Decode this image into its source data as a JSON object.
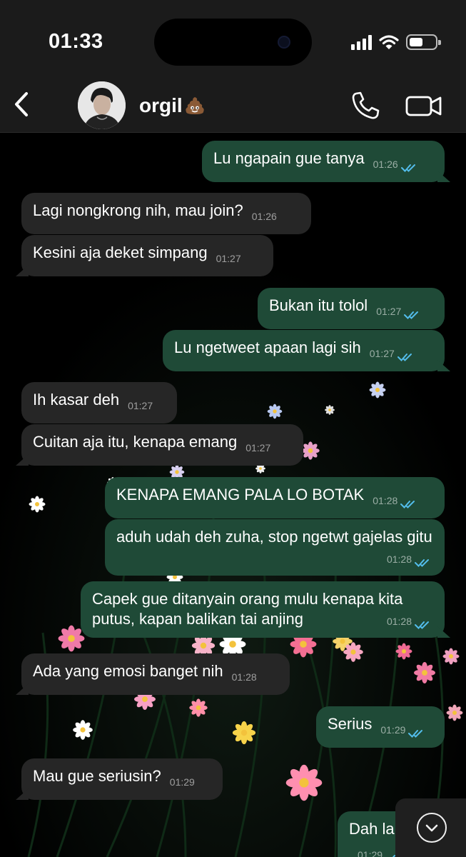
{
  "status_bar": {
    "time": "01:33"
  },
  "header": {
    "contact_name": "orgil",
    "name_emoji_icon": "poop-icon"
  },
  "colors": {
    "outgoing_bubble": "#1f4a37",
    "incoming_bubble": "#262626",
    "read_ticks": "#53bdeb",
    "header_bg": "#1b1b1b"
  },
  "messages": [
    {
      "dir": "out",
      "text": "Lu ngapain gue tanya",
      "time": "01:26",
      "read": true
    },
    {
      "dir": "in",
      "text": "Lagi nongkrong nih, mau join?",
      "time": "01:26"
    },
    {
      "dir": "in",
      "text": "Kesini aja deket simpang",
      "time": "01:27"
    },
    {
      "dir": "out",
      "text": "Bukan itu tolol",
      "time": "01:27",
      "read": true
    },
    {
      "dir": "out",
      "text": "Lu ngetweet apaan lagi sih",
      "time": "01:27",
      "read": true
    },
    {
      "dir": "in",
      "text": "Ih kasar deh",
      "time": "01:27"
    },
    {
      "dir": "in",
      "text": "Cuitan aja itu, kenapa emang",
      "time": "01:27"
    },
    {
      "dir": "out",
      "text": "KENAPA EMANG PALA LO BOTAK",
      "time": "01:28",
      "read": true
    },
    {
      "dir": "out",
      "text": "aduh udah deh zuha, stop ngetwt gajelas gitu",
      "time": "01:28",
      "read": true
    },
    {
      "dir": "out",
      "text": "Capek gue ditanyain orang mulu kenapa kita putus, kapan balikan tai anjing",
      "time": "01:28",
      "read": true
    },
    {
      "dir": "in",
      "text": "Ada yang emosi banget nih",
      "time": "01:28"
    },
    {
      "dir": "out",
      "text": "Serius",
      "time": "01:29",
      "read": true
    },
    {
      "dir": "in",
      "text": "Mau gue seriusin?",
      "time": "01:29"
    },
    {
      "dir": "out",
      "text": "Dah lah",
      "time": "01:29",
      "read": true
    }
  ]
}
